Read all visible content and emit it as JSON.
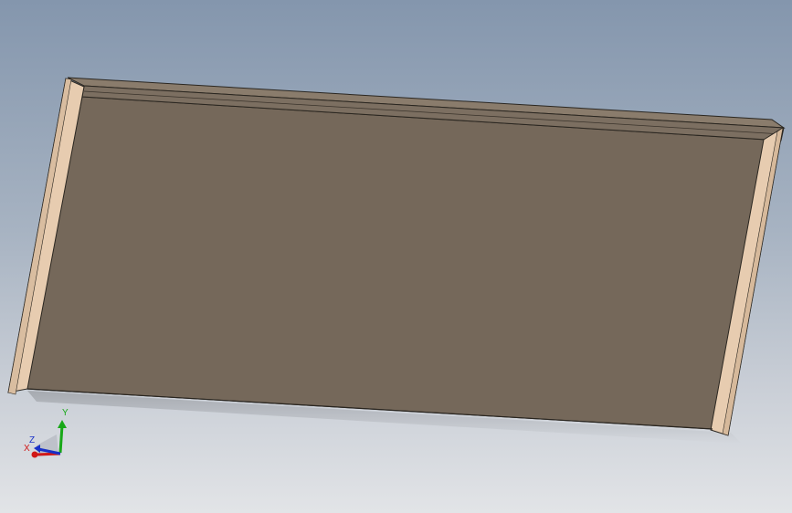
{
  "viewport": {
    "background_top": "#8496ad",
    "background_bottom": "#e2e4e7"
  },
  "model": {
    "panel_color": "#75685a",
    "frame_color": "#e7ccb0",
    "edge_color": "#2a2620"
  },
  "triad": {
    "x_label": "X",
    "y_label": "Y",
    "z_label": "Z",
    "x_color": "#d01818",
    "y_color": "#18a818",
    "z_color": "#1830c8"
  }
}
